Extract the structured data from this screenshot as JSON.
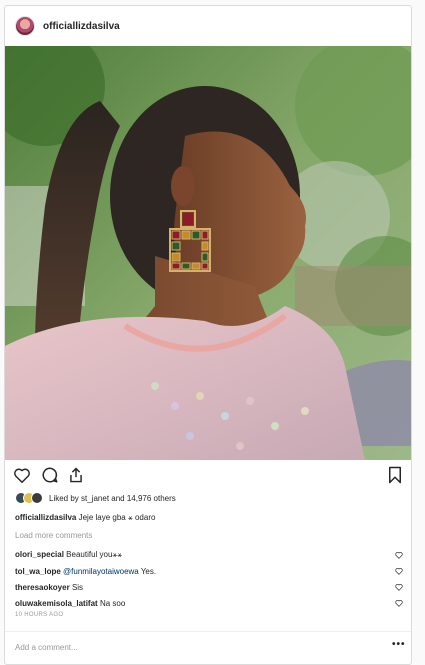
{
  "post": {
    "username": "officiallizdasilva",
    "photo_alt": "Woman in profile with a ponytail wearing large square jeweled earrings and a sheer sequined pink top",
    "liked_by": "Liked by st_janet and 14,976 others",
    "caption": {
      "user": "officiallizdasilva",
      "text": "Jeje laye gba ⚹ odaro"
    },
    "load_more": "Load more comments",
    "comments": [
      {
        "user": "olori_special",
        "text": "Beautiful you⚹⚹"
      },
      {
        "user": "tol_wa_lope",
        "mention": "@funmilayotaiwoewa",
        "text": "Yes."
      },
      {
        "user": "theresaokoyer",
        "text": "Sis"
      },
      {
        "user": "oluwakemisola_latifat",
        "text": "Na soo"
      }
    ],
    "timestamp": "10 HOURS AGO",
    "add_comment_placeholder": "Add a comment...",
    "more_label": "•••"
  },
  "icons": {
    "like": "heart-icon",
    "comment": "comment-icon",
    "share": "share-icon",
    "save": "bookmark-icon"
  },
  "colors": {
    "text": "#262626",
    "muted": "#999999",
    "border": "#dbdbdb",
    "mention": "#003569"
  }
}
